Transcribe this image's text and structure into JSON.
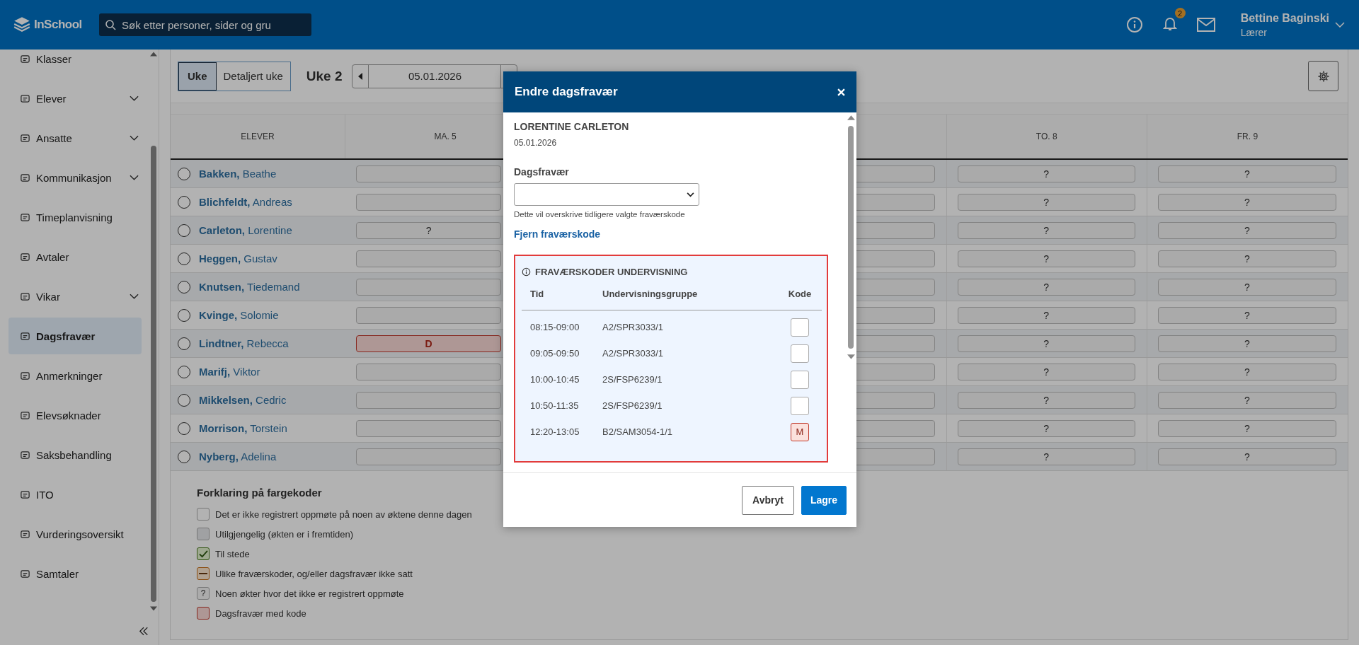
{
  "topbar": {
    "logo": "InSchool",
    "search": {
      "placeholder": "Søk etter personer, sider og gru"
    },
    "notifications": {
      "count": "2"
    },
    "user": {
      "name": "Bettine Baginski",
      "role": "Lærer"
    }
  },
  "sidebar": {
    "items": [
      {
        "label": "Klasser",
        "expandable": false,
        "selected": false
      },
      {
        "label": "Elever",
        "expandable": true,
        "selected": false
      },
      {
        "label": "Ansatte",
        "expandable": true,
        "selected": false
      },
      {
        "label": "Kommunikasjon",
        "expandable": true,
        "selected": false
      },
      {
        "label": "Timeplanvisning",
        "expandable": false,
        "selected": false
      },
      {
        "label": "Avtaler",
        "expandable": false,
        "selected": false
      },
      {
        "label": "Vikar",
        "expandable": true,
        "selected": false
      },
      {
        "label": "Dagsfravær",
        "expandable": false,
        "selected": true
      },
      {
        "label": "Anmerkninger",
        "expandable": false,
        "selected": false
      },
      {
        "label": "Elevsøknader",
        "expandable": false,
        "selected": false
      },
      {
        "label": "Saksbehandling",
        "expandable": false,
        "selected": false
      },
      {
        "label": "ITO",
        "expandable": false,
        "selected": false
      },
      {
        "label": "Vurderingsoversikt",
        "expandable": false,
        "selected": false
      },
      {
        "label": "Samtaler",
        "expandable": false,
        "selected": false
      }
    ]
  },
  "view_tabs": [
    {
      "label": "Uke",
      "selected": true
    },
    {
      "label": "Detaljert uke",
      "selected": false
    }
  ],
  "week": {
    "label": "Uke 2",
    "date": "05.01.2026"
  },
  "table": {
    "student_header": "ELEVER",
    "day_columns": [
      {
        "kind": "day",
        "header": "MA. 5"
      },
      {
        "kind": "covered"
      },
      {
        "kind": "covered"
      },
      {
        "kind": "day",
        "header": "TO. 8"
      },
      {
        "kind": "day",
        "header": "FR. 9"
      }
    ],
    "rows": [
      {
        "last": "Bakken,",
        "first": "Beathe",
        "checked": false,
        "cells": [
          {
            "kind": "empty"
          },
          {
            "kind": "empty"
          },
          {
            "kind": "empty"
          },
          {
            "kind": "unknown",
            "text": "?"
          },
          {
            "kind": "unknown",
            "text": "?"
          }
        ]
      },
      {
        "last": "Blichfeldt,",
        "first": "Andreas",
        "checked": false,
        "cells": [
          {
            "kind": "empty"
          },
          {
            "kind": "empty"
          },
          {
            "kind": "empty"
          },
          {
            "kind": "unknown",
            "text": "?"
          },
          {
            "kind": "unknown",
            "text": "?"
          }
        ]
      },
      {
        "last": "Carleton,",
        "first": "Lorentine",
        "checked": false,
        "cells": [
          {
            "kind": "unknown",
            "text": "?"
          },
          {
            "kind": "empty"
          },
          {
            "kind": "empty"
          },
          {
            "kind": "unknown",
            "text": "?"
          },
          {
            "kind": "unknown",
            "text": "?"
          }
        ]
      },
      {
        "last": "Heggen,",
        "first": "Gustav",
        "checked": false,
        "cells": [
          {
            "kind": "empty"
          },
          {
            "kind": "empty"
          },
          {
            "kind": "empty"
          },
          {
            "kind": "unknown",
            "text": "?"
          },
          {
            "kind": "unknown",
            "text": "?"
          }
        ]
      },
      {
        "last": "Knutsen,",
        "first": "Tiedemand",
        "checked": false,
        "cells": [
          {
            "kind": "empty"
          },
          {
            "kind": "empty"
          },
          {
            "kind": "empty"
          },
          {
            "kind": "unknown",
            "text": "?"
          },
          {
            "kind": "unknown",
            "text": "?"
          }
        ]
      },
      {
        "last": "Kvinge,",
        "first": "Solomie",
        "checked": false,
        "cells": [
          {
            "kind": "empty"
          },
          {
            "kind": "empty"
          },
          {
            "kind": "empty"
          },
          {
            "kind": "unknown",
            "text": "?"
          },
          {
            "kind": "unknown",
            "text": "?"
          }
        ]
      },
      {
        "last": "Lindtner,",
        "first": "Rebecca",
        "checked": false,
        "cells": [
          {
            "kind": "coded",
            "text": "D"
          },
          {
            "kind": "empty"
          },
          {
            "kind": "empty"
          },
          {
            "kind": "unknown",
            "text": "?"
          },
          {
            "kind": "unknown",
            "text": "?"
          }
        ]
      },
      {
        "last": "Marifj,",
        "first": "Viktor",
        "checked": false,
        "cells": [
          {
            "kind": "empty"
          },
          {
            "kind": "empty"
          },
          {
            "kind": "empty"
          },
          {
            "kind": "unknown",
            "text": "?"
          },
          {
            "kind": "unknown",
            "text": "?"
          }
        ]
      },
      {
        "last": "Mikkelsen,",
        "first": "Cedric",
        "checked": false,
        "cells": [
          {
            "kind": "empty"
          },
          {
            "kind": "empty"
          },
          {
            "kind": "empty"
          },
          {
            "kind": "unknown",
            "text": "?"
          },
          {
            "kind": "unknown",
            "text": "?"
          }
        ]
      },
      {
        "last": "Morrison,",
        "first": "Torstein",
        "checked": false,
        "cells": [
          {
            "kind": "empty"
          },
          {
            "kind": "empty"
          },
          {
            "kind": "empty"
          },
          {
            "kind": "unknown",
            "text": "?"
          },
          {
            "kind": "unknown",
            "text": "?"
          }
        ]
      },
      {
        "last": "Nyberg,",
        "first": "Adelina",
        "checked": false,
        "cells": [
          {
            "kind": "empty"
          },
          {
            "kind": "empty"
          },
          {
            "kind": "empty"
          },
          {
            "kind": "unknown",
            "text": "?"
          },
          {
            "kind": "unknown",
            "text": "?"
          }
        ]
      }
    ]
  },
  "legend": {
    "title": "Forklaring på fargekoder",
    "items": [
      {
        "kind": "none",
        "text": "Det er ikke registrert oppmøte på noen av øktene denne dagen"
      },
      {
        "kind": "unavailable",
        "text": "Utilgjengelig (økten er i fremtiden)"
      },
      {
        "kind": "present",
        "text": "Til stede"
      },
      {
        "kind": "mixed",
        "text": "Ulike fraværskoder, og/eller dagsfravær ikke satt"
      },
      {
        "kind": "unknown",
        "symbol": "?",
        "text": "Noen økter hvor det ikke er registrert oppmøte"
      },
      {
        "kind": "coded",
        "text": "Dagsfravær med kode"
      }
    ]
  },
  "modal": {
    "title": "Endre dagsfravær",
    "student": "LORENTINE CARLETON",
    "date": "05.01.2026",
    "field_label": "Dagsfravær",
    "hint": "Dette vil overskrive tidligere valgte fraværskode",
    "remove_link": "Fjern fraværskode",
    "section": {
      "title": "FRAVÆRSKODER UNDERVISNING",
      "highlighted": true,
      "columns": [
        "Tid",
        "Undervisningsgruppe",
        "Kode"
      ],
      "rows": [
        {
          "time": "08:15-09:00",
          "group": "A2/SPR3033/1",
          "code": {
            "kind": "empty"
          }
        },
        {
          "time": "09:05-09:50",
          "group": "A2/SPR3033/1",
          "code": {
            "kind": "empty"
          }
        },
        {
          "time": "10:00-10:45",
          "group": "2S/FSP6239/1",
          "code": {
            "kind": "empty"
          }
        },
        {
          "time": "10:50-11:35",
          "group": "2S/FSP6239/1",
          "code": {
            "kind": "empty"
          }
        },
        {
          "time": "12:20-13:05",
          "group": "B2/SAM3054-1/1",
          "code": {
            "kind": "coded",
            "text": "M"
          }
        }
      ]
    },
    "buttons": [
      {
        "kind": "secondary",
        "label": "Avbryt"
      },
      {
        "kind": "primary",
        "label": "Lagre"
      }
    ]
  }
}
